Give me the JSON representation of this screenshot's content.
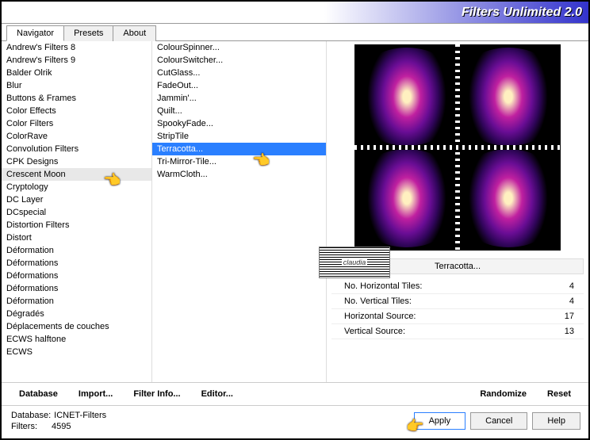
{
  "header": {
    "title": "Filters Unlimited 2.0"
  },
  "tabs": [
    {
      "label": "Navigator",
      "active": true
    },
    {
      "label": "Presets",
      "active": false
    },
    {
      "label": "About",
      "active": false
    }
  ],
  "categories": [
    "Andrew's Filters 8",
    "Andrew's Filters 9",
    "Balder Olrik",
    "Blur",
    "Buttons & Frames",
    "Color Effects",
    "Color Filters",
    "ColorRave",
    "Convolution Filters",
    "CPK Designs",
    "Crescent Moon",
    "Cryptology",
    "DC Layer",
    "DCspecial",
    "Distortion Filters",
    "Distort",
    "Déformation",
    "Déformations",
    "Déformations",
    "Déformations",
    "Déformation",
    "Dégradés",
    "Déplacements de couches",
    "ECWS halftone",
    "ECWS"
  ],
  "category_selected": "Crescent Moon",
  "filters": [
    "ColourSpinner...",
    "ColourSwitcher...",
    "CutGlass...",
    "FadeOut...",
    "Jammin'...",
    "Quilt...",
    "SpookyFade...",
    "StripTile",
    "Terracotta...",
    "Tri-Mirror-Tile...",
    "WarmCloth..."
  ],
  "filter_selected": "Terracotta...",
  "settings_title": "Terracotta...",
  "settings": [
    {
      "label": "No. Horizontal Tiles:",
      "value": "4"
    },
    {
      "label": "No. Vertical Tiles:",
      "value": "4"
    },
    {
      "label": "Horizontal Source:",
      "value": "17"
    },
    {
      "label": "Vertical Source:",
      "value": "13"
    }
  ],
  "link_row": {
    "database": "Database",
    "import": "Import...",
    "filter_info": "Filter Info...",
    "editor": "Editor...",
    "randomize": "Randomize",
    "reset": "Reset"
  },
  "status": {
    "db_label": "Database:",
    "db_value": "ICNET-Filters",
    "filters_label": "Filters:",
    "filters_value": "4595"
  },
  "buttons": {
    "apply": "Apply",
    "cancel": "Cancel",
    "help": "Help"
  },
  "badge": {
    "text": "claudia"
  }
}
